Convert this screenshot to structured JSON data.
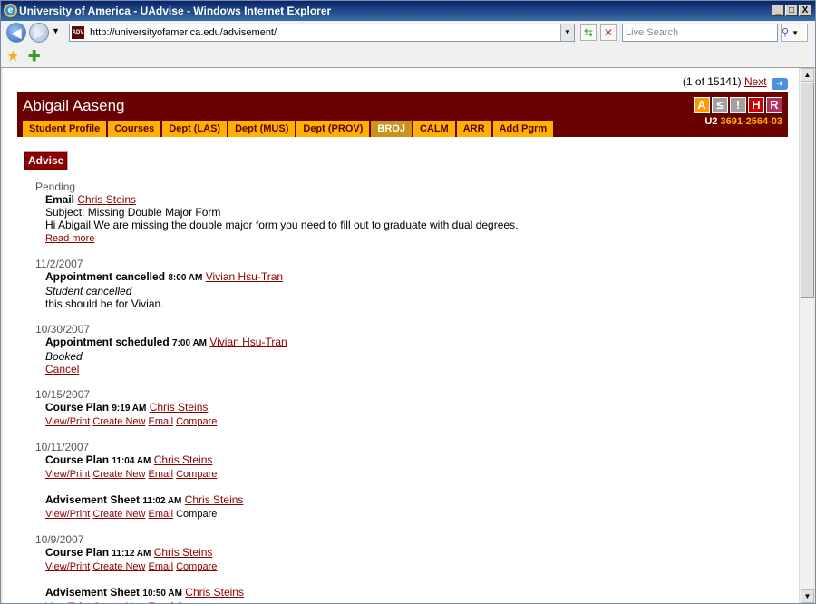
{
  "window": {
    "title": "University of America - UAdvise - Windows Internet Explorer",
    "minimize": "_",
    "maximize": "□",
    "close": "X"
  },
  "toolbar": {
    "url": "http://universityofamerica.edu/advisement/",
    "site_icon": "ADV",
    "search_placeholder": "Live Search"
  },
  "pager": {
    "text": "(1 of 15141)",
    "next_label": "Next"
  },
  "student": {
    "name": "Abigail Aaseng",
    "id_prefix": "U2",
    "id_number": "3691-2564-03",
    "flags": [
      {
        "label": "A",
        "color": "#ff9900"
      },
      {
        "label": "≤",
        "color": "#a0a0a0"
      },
      {
        "label": "!",
        "color": "#a0a0a0"
      },
      {
        "label": "H",
        "color": "#cc0000"
      },
      {
        "label": "R",
        "color": "#b03060"
      }
    ]
  },
  "tabs": [
    "Student Profile",
    "Courses",
    "Dept (LAS)",
    "Dept (MUS)",
    "Dept (PROV)",
    "BROJ",
    "CALM",
    "ARR",
    "Add Pgrm"
  ],
  "advise_label": "Advise",
  "feed": {
    "pending": {
      "label": "Pending",
      "title": "Email",
      "person": "Chris Steins",
      "subject": "Subject: Missing Double Major Form",
      "body": "Hi Abigail,We are missing the double major form you need to fill out to graduate with dual degrees.",
      "read_more": "Read more"
    },
    "d1": {
      "date": "11/2/2007",
      "title": "Appointment cancelled",
      "time": "8:00 AM",
      "person": "Vivian Hsu-Tran",
      "status": "Student cancelled",
      "note": "this should be for Vivian."
    },
    "d2": {
      "date": "10/30/2007",
      "title": "Appointment scheduled",
      "time": "7:00 AM",
      "person": "Vivian Hsu-Tran",
      "status": "Booked",
      "cancel": "Cancel"
    },
    "d3": {
      "date": "10/15/2007",
      "title": "Course Plan",
      "time": "9:19 AM",
      "person": "Chris Steins"
    },
    "d4": {
      "date": "10/11/2007",
      "e1": {
        "title": "Course Plan",
        "time": "11:04 AM",
        "person": "Chris Steins"
      },
      "e2": {
        "title": "Advisement Sheet",
        "time": "11:02 AM",
        "person": "Chris Steins"
      }
    },
    "d5": {
      "date": "10/9/2007",
      "e1": {
        "title": "Course Plan",
        "time": "11:12 AM",
        "person": "Chris Steins"
      },
      "e2": {
        "title": "Advisement Sheet",
        "time": "10:50 AM",
        "person": "Chris Steins"
      }
    },
    "actions": {
      "view_print": "View/Print",
      "create_new": "Create New",
      "email": "Email",
      "compare": "Compare"
    }
  }
}
